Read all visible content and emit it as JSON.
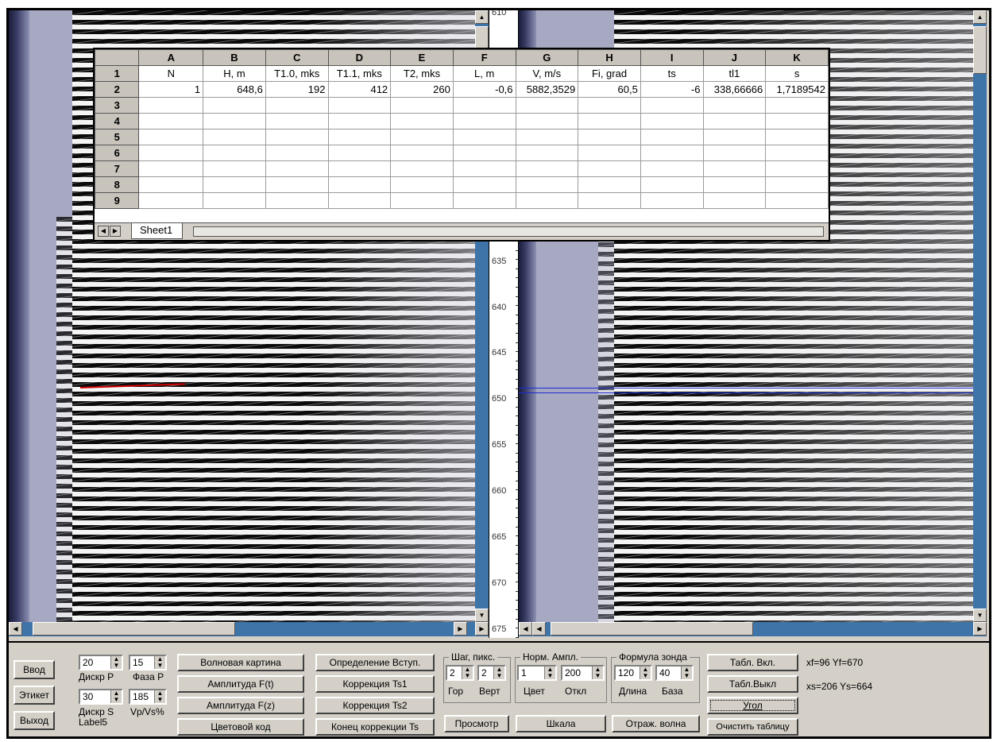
{
  "sheet": {
    "col_headers": [
      "",
      "A",
      "B",
      "C",
      "D",
      "E",
      "F",
      "G",
      "H",
      "I",
      "J",
      "K"
    ],
    "row_numbers": [
      "1",
      "2",
      "3",
      "4",
      "5",
      "6",
      "7",
      "8",
      "9"
    ],
    "header_row": [
      "N",
      "H, m",
      "T1.0, mks",
      "T1.1, mks",
      "T2, mks",
      "L, m",
      "V, m/s",
      "Fi, grad",
      "ts",
      "tl1",
      "s"
    ],
    "data_row": [
      "1",
      "648,6",
      "192",
      "412",
      "260",
      "-0,6",
      "5882,3529",
      "60,5",
      "-6",
      "338,66666",
      "1,7189542"
    ],
    "tab_name": "Sheet1"
  },
  "depth_scale": {
    "labels": [
      "610",
      "635",
      "640",
      "645",
      "650",
      "655",
      "660",
      "665",
      "670",
      "675"
    ]
  },
  "panel": {
    "vvod": "Ввод",
    "etiket": "Этикет",
    "vykhod": "Выход",
    "disk_p_value": "20",
    "disk_p_label": "Дискр P",
    "faza_p_value": "15",
    "faza_p_label": "Фаза P",
    "disk_s_value": "30",
    "disk_s_label": "Дискр S",
    "label5": "Label5",
    "vpvs_value": "185",
    "vpvs_label": "Vp/Vs%",
    "volnovaya": "Волновая картина",
    "ampl_ft": "Амплитуда F(t)",
    "ampl_fz": "Амплитуда F(z)",
    "tsvet_kod": "Цветовой код",
    "opred_vstup": "Определение Вступ.",
    "korr_ts1": "Коррекция Ts1",
    "korr_ts2": "Коррекция Ts2",
    "konets_korr": "Конец коррекции Ts",
    "shag_title": "Шаг, пикс.",
    "shag_gor_value": "2",
    "shag_vert_value": "2",
    "gor": "Гор",
    "vert": "Верт",
    "norm_title": "Норм. Ампл.",
    "tsvet_value": "1",
    "otkl_value": "200",
    "tsvet": "Цвет",
    "otkl": "Откл",
    "formula_title": "Формула зонда",
    "dlina_value": "120",
    "baza_value": "40",
    "dlina": "Длина",
    "baza": "База",
    "prosmotr": "Просмотр",
    "shkala": "Шкала",
    "otrazh": "Отраж. волна",
    "tabl_vkl": "Табл. Вкл.",
    "tabl_vykl": "Табл.Выкл",
    "ugol": "Угол",
    "ochistit": "Очистить таблицу",
    "info1": "xf=96  Yf=670",
    "info2": "xs=206  Ys=664"
  }
}
